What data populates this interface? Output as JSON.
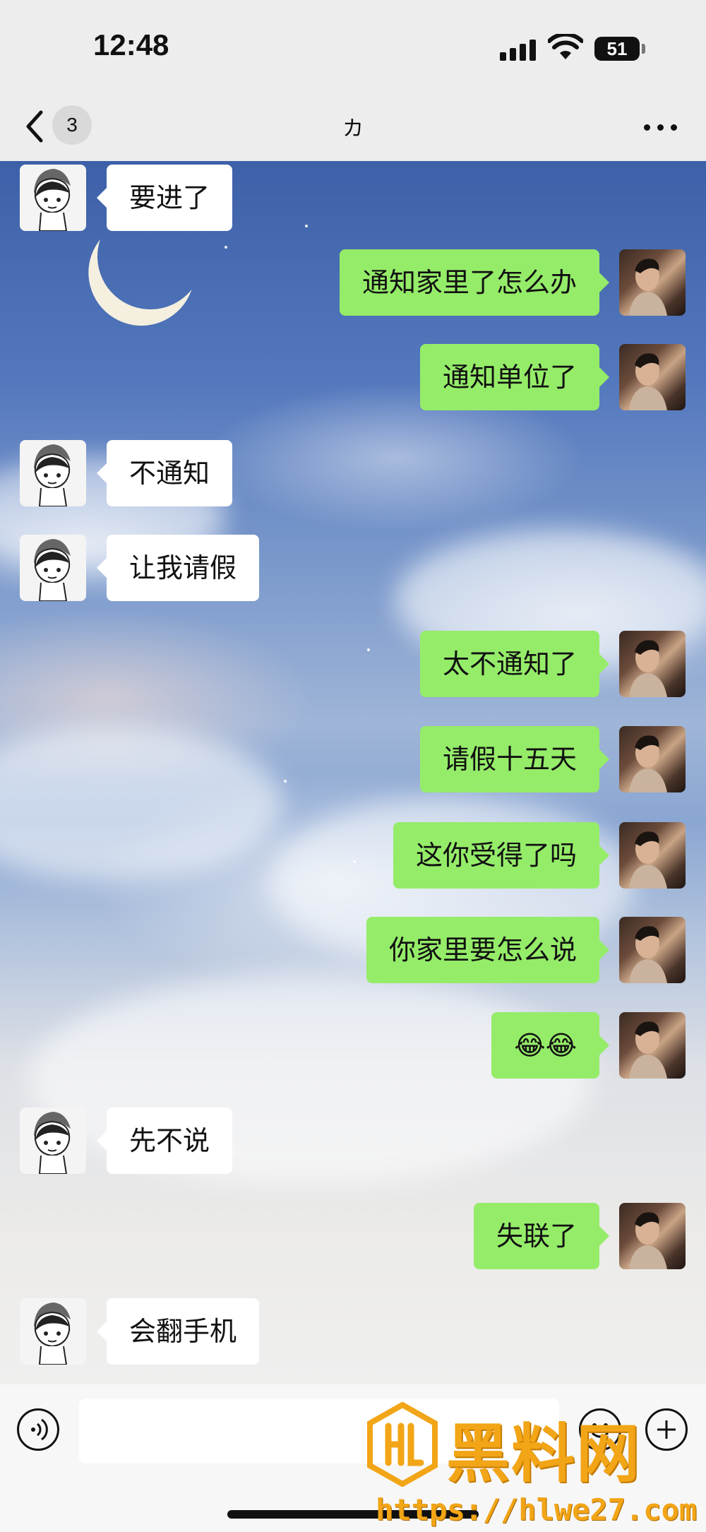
{
  "status_bar": {
    "time": "12:48",
    "battery": "51",
    "signal_icon": "cellular-signal-icon",
    "wifi_icon": "wifi-icon"
  },
  "nav": {
    "back_icon": "chevron-left-icon",
    "unread_count": "3",
    "title": "カ",
    "more_icon": "ellipsis-icon"
  },
  "messages": [
    {
      "side": "in",
      "text": "要进了"
    },
    {
      "side": "out",
      "text": "通知家里了怎么办"
    },
    {
      "side": "out",
      "text": "通知单位了"
    },
    {
      "side": "in",
      "text": "不通知"
    },
    {
      "side": "in",
      "text": "让我请假"
    },
    {
      "side": "out",
      "text": "太不通知了"
    },
    {
      "side": "out",
      "text": "请假十五天"
    },
    {
      "side": "out",
      "text": "这你受得了吗"
    },
    {
      "side": "out",
      "text": "你家里要怎么说"
    },
    {
      "side": "out",
      "text": "😂😂"
    },
    {
      "side": "in",
      "text": "先不说"
    },
    {
      "side": "out",
      "text": "失联了"
    },
    {
      "side": "in",
      "text": "会翻手机"
    }
  ],
  "input_bar": {
    "voice_icon": "voice-icon",
    "input_value": "",
    "emoji_icon": "emoji-icon",
    "plus_icon": "plus-icon"
  },
  "watermark": {
    "title": "黑料网",
    "url": "https://hlwe27.com"
  },
  "colors": {
    "outgoing_bubble": "#95ec69",
    "incoming_bubble": "#ffffff",
    "nav_background": "#ededed",
    "watermark": "#f2a516"
  }
}
